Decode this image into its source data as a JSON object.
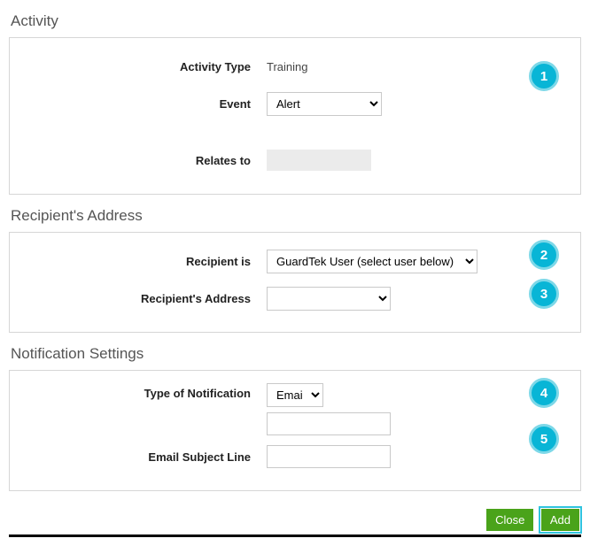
{
  "sections": {
    "activity": {
      "title": "Activity",
      "activityTypeLabel": "Activity Type",
      "activityTypeValue": "Training",
      "eventLabel": "Event",
      "eventValue": "Alert",
      "relatesToLabel": "Relates to",
      "badge1": "1"
    },
    "recipient": {
      "title": "Recipient's Address",
      "recipientIsLabel": "Recipient is",
      "recipientIsValue": "GuardTek User (select user below)",
      "addressLabel": "Recipient's Address",
      "addressValue": "",
      "badge2": "2",
      "badge3": "3"
    },
    "notification": {
      "title": "Notification Settings",
      "typeLabel": "Type of Notification",
      "typeValue": "Email",
      "extraValue": "",
      "subjectLabel": "Email Subject Line",
      "subjectValue": "",
      "badge4": "4",
      "badge5": "5"
    }
  },
  "buttons": {
    "close": "Close",
    "add": "Add"
  }
}
